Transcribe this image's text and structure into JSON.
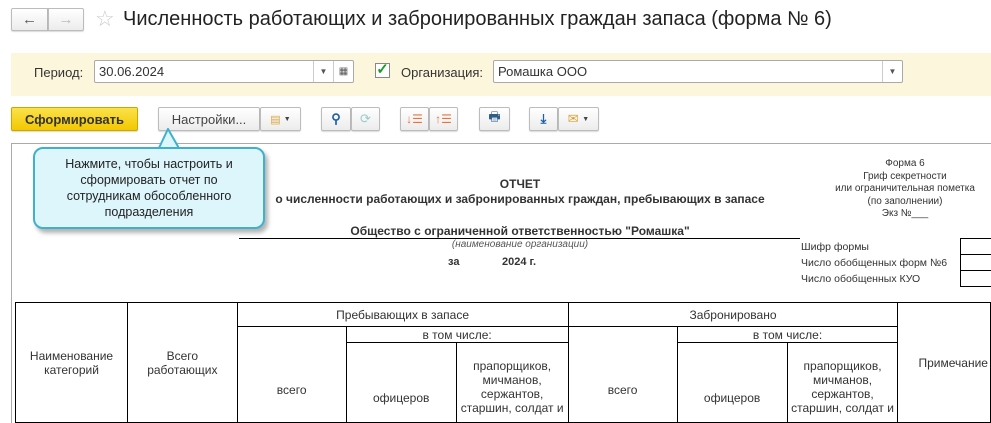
{
  "window": {
    "title": "Численность работающих и забронированных граждан запаса (форма № 6)",
    "back": "←",
    "forward": "→",
    "star": "☆"
  },
  "filters": {
    "period_label": "Период:",
    "period_value": "30.06.2024",
    "org_label": "Организация:",
    "org_value": "Ромашка ООО",
    "org_checked": true
  },
  "toolbar": {
    "generate": "Сформировать",
    "settings": "Настройки..."
  },
  "tooltip": "Нажмите, чтобы настроить и сформировать отчет по сотрудникам обособленного подразделения",
  "report": {
    "heading": "ОТЧЕТ",
    "subheading": "о численности работающих и забронированных граждан, пребывающих в запасе",
    "org_name": "Общество с ограниченной ответственностью \"Ромашка\"",
    "org_caption": "(наименование организации)",
    "for": "за",
    "year": "2024 г.",
    "form_info": [
      "Форма 6",
      "Гриф секретности",
      "или ограничительная пометка",
      "(по заполнении)",
      "Экз №___"
    ],
    "codes": [
      "Шифр формы",
      "Число обобщенных форм №6",
      "Число обобщенных КУО"
    ],
    "table": {
      "col_name": "Наименование категорий",
      "col_total": "Всего работающих",
      "group_reserve": "Пребывающих в запасе",
      "group_reserved": "Забронировано",
      "including": "в том числе:",
      "all": "всего",
      "officers": "офицеров",
      "others": "прапорщиков, мичманов, сержантов, старшин, солдат и",
      "note": "Примечание"
    }
  }
}
